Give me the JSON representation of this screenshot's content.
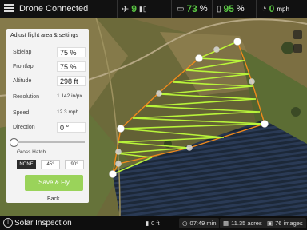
{
  "header": {
    "title": "Drone Connected",
    "satellites": "9",
    "battery_drone": "73",
    "battery_drone_unit": "%",
    "battery_controller": "95",
    "battery_controller_unit": "%",
    "speed": "0",
    "speed_unit": "mph"
  },
  "panel": {
    "title": "Adjust flight area & settings",
    "fields": [
      {
        "label": "Sidelap",
        "value": "75 %"
      },
      {
        "label": "Frontlap",
        "value": "75 %"
      },
      {
        "label": "Altitude",
        "value": "298 ft"
      },
      {
        "label": "Resolution",
        "value": "1.142 in/px"
      },
      {
        "label": "Speed",
        "value": "12.3 mph"
      },
      {
        "label": "Direction",
        "value": "0 °"
      }
    ],
    "grid_hatch_label": "Gross Hatch",
    "hatch_options": [
      "NONE",
      "45°",
      "90°"
    ],
    "hatch_selected": "NONE",
    "save_button": "Save & Fly",
    "back_button": "Back"
  },
  "footer": {
    "mission_name": "Solar Inspection",
    "altitude_readout": "0 ft",
    "time": "07:49 min",
    "area": "11.35 acres",
    "images": "76 images"
  },
  "colors": {
    "accent_green": "#59c442",
    "flight_path": "#b9f53a",
    "boundary": "#f08a1c"
  }
}
